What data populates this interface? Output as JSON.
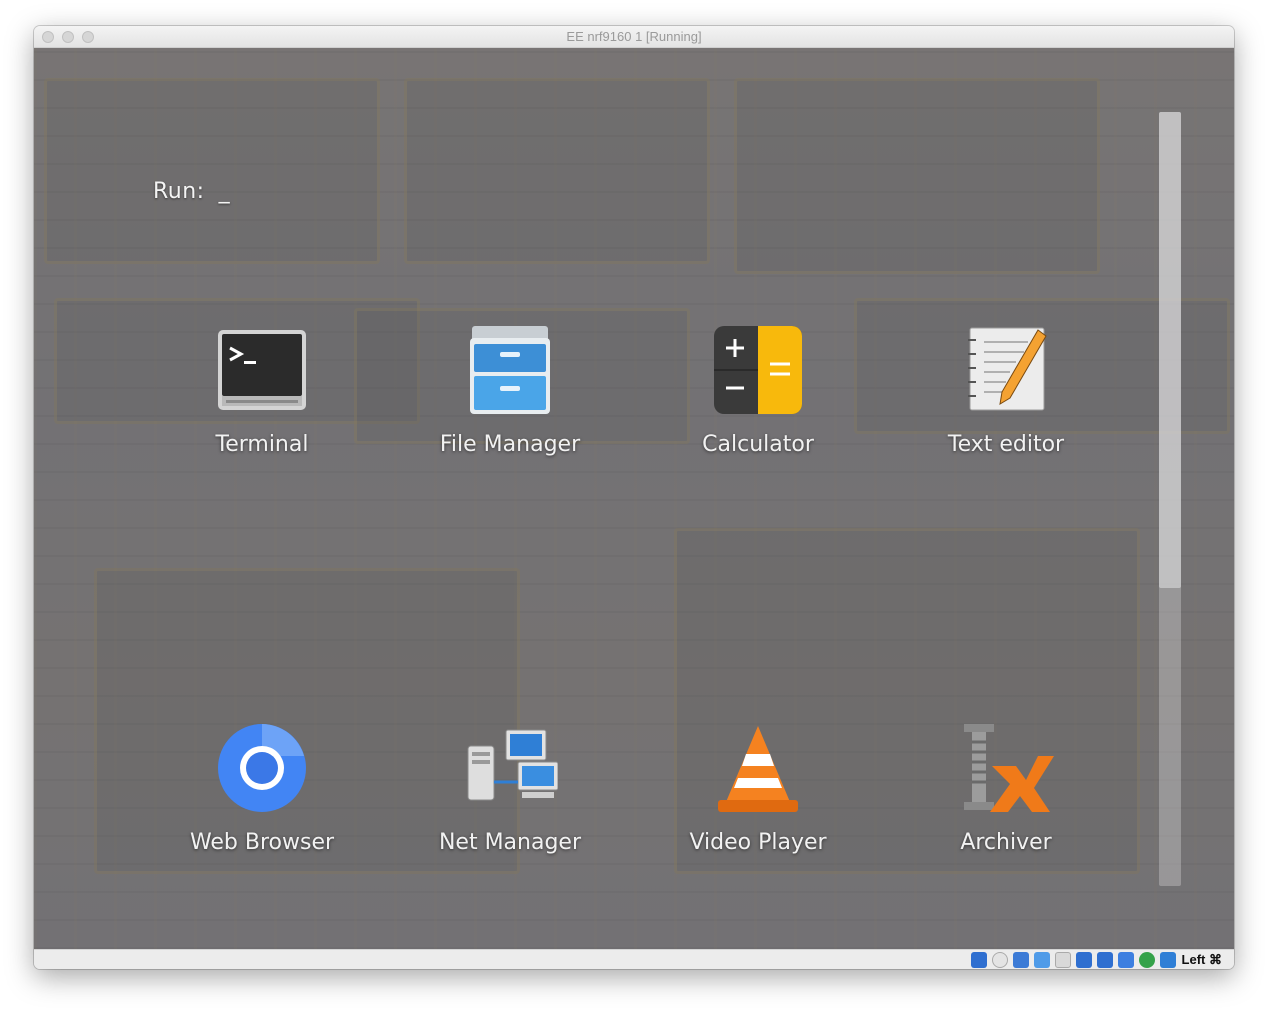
{
  "window": {
    "title": "EE nrf9160 1 [Running]"
  },
  "launcher": {
    "run_label": "Run:",
    "run_value": "_",
    "apps": [
      {
        "label": "Terminal",
        "icon": "terminal-icon"
      },
      {
        "label": "File Manager",
        "icon": "file-manager-icon"
      },
      {
        "label": "Calculator",
        "icon": "calculator-icon"
      },
      {
        "label": "Text editor",
        "icon": "text-editor-icon"
      },
      {
        "label": "Web Browser",
        "icon": "web-browser-icon"
      },
      {
        "label": "Net Manager",
        "icon": "net-manager-icon"
      },
      {
        "label": "Video Player",
        "icon": "video-player-icon"
      },
      {
        "label": "Archiver",
        "icon": "archiver-icon"
      }
    ],
    "scroll_position": 0
  },
  "statusbar": {
    "host_key": "Left ⌘",
    "indicators": [
      "hard-disk-icon",
      "optical-drive-icon",
      "audio-icon",
      "usb-icon",
      "shared-folders-icon",
      "display-icon",
      "video-capture-icon",
      "cpu-icon",
      "network-icon",
      "mouse-integration-icon"
    ]
  },
  "colors": {
    "terminal_body": "#2b2b2b",
    "file_manager_blue": "#3d8fd6",
    "calculator_yellow": "#f8b90c",
    "calculator_dark": "#3a3a3a",
    "chromium_blue": "#4285f4",
    "vlc_orange": "#f58220",
    "archiver_orange": "#f07a19"
  }
}
